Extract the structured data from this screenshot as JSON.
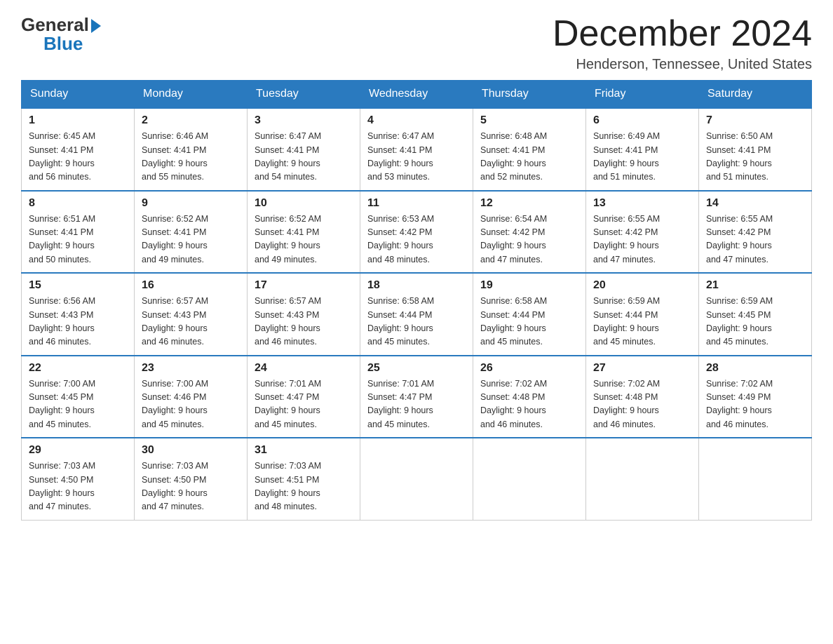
{
  "header": {
    "logo_general": "General",
    "logo_blue": "Blue",
    "month_title": "December 2024",
    "location": "Henderson, Tennessee, United States"
  },
  "days_of_week": [
    "Sunday",
    "Monday",
    "Tuesday",
    "Wednesday",
    "Thursday",
    "Friday",
    "Saturday"
  ],
  "weeks": [
    [
      {
        "date": "1",
        "sunrise": "6:45 AM",
        "sunset": "4:41 PM",
        "daylight": "9 hours and 56 minutes."
      },
      {
        "date": "2",
        "sunrise": "6:46 AM",
        "sunset": "4:41 PM",
        "daylight": "9 hours and 55 minutes."
      },
      {
        "date": "3",
        "sunrise": "6:47 AM",
        "sunset": "4:41 PM",
        "daylight": "9 hours and 54 minutes."
      },
      {
        "date": "4",
        "sunrise": "6:47 AM",
        "sunset": "4:41 PM",
        "daylight": "9 hours and 53 minutes."
      },
      {
        "date": "5",
        "sunrise": "6:48 AM",
        "sunset": "4:41 PM",
        "daylight": "9 hours and 52 minutes."
      },
      {
        "date": "6",
        "sunrise": "6:49 AM",
        "sunset": "4:41 PM",
        "daylight": "9 hours and 51 minutes."
      },
      {
        "date": "7",
        "sunrise": "6:50 AM",
        "sunset": "4:41 PM",
        "daylight": "9 hours and 51 minutes."
      }
    ],
    [
      {
        "date": "8",
        "sunrise": "6:51 AM",
        "sunset": "4:41 PM",
        "daylight": "9 hours and 50 minutes."
      },
      {
        "date": "9",
        "sunrise": "6:52 AM",
        "sunset": "4:41 PM",
        "daylight": "9 hours and 49 minutes."
      },
      {
        "date": "10",
        "sunrise": "6:52 AM",
        "sunset": "4:41 PM",
        "daylight": "9 hours and 49 minutes."
      },
      {
        "date": "11",
        "sunrise": "6:53 AM",
        "sunset": "4:42 PM",
        "daylight": "9 hours and 48 minutes."
      },
      {
        "date": "12",
        "sunrise": "6:54 AM",
        "sunset": "4:42 PM",
        "daylight": "9 hours and 47 minutes."
      },
      {
        "date": "13",
        "sunrise": "6:55 AM",
        "sunset": "4:42 PM",
        "daylight": "9 hours and 47 minutes."
      },
      {
        "date": "14",
        "sunrise": "6:55 AM",
        "sunset": "4:42 PM",
        "daylight": "9 hours and 47 minutes."
      }
    ],
    [
      {
        "date": "15",
        "sunrise": "6:56 AM",
        "sunset": "4:43 PM",
        "daylight": "9 hours and 46 minutes."
      },
      {
        "date": "16",
        "sunrise": "6:57 AM",
        "sunset": "4:43 PM",
        "daylight": "9 hours and 46 minutes."
      },
      {
        "date": "17",
        "sunrise": "6:57 AM",
        "sunset": "4:43 PM",
        "daylight": "9 hours and 46 minutes."
      },
      {
        "date": "18",
        "sunrise": "6:58 AM",
        "sunset": "4:44 PM",
        "daylight": "9 hours and 45 minutes."
      },
      {
        "date": "19",
        "sunrise": "6:58 AM",
        "sunset": "4:44 PM",
        "daylight": "9 hours and 45 minutes."
      },
      {
        "date": "20",
        "sunrise": "6:59 AM",
        "sunset": "4:44 PM",
        "daylight": "9 hours and 45 minutes."
      },
      {
        "date": "21",
        "sunrise": "6:59 AM",
        "sunset": "4:45 PM",
        "daylight": "9 hours and 45 minutes."
      }
    ],
    [
      {
        "date": "22",
        "sunrise": "7:00 AM",
        "sunset": "4:45 PM",
        "daylight": "9 hours and 45 minutes."
      },
      {
        "date": "23",
        "sunrise": "7:00 AM",
        "sunset": "4:46 PM",
        "daylight": "9 hours and 45 minutes."
      },
      {
        "date": "24",
        "sunrise": "7:01 AM",
        "sunset": "4:47 PM",
        "daylight": "9 hours and 45 minutes."
      },
      {
        "date": "25",
        "sunrise": "7:01 AM",
        "sunset": "4:47 PM",
        "daylight": "9 hours and 45 minutes."
      },
      {
        "date": "26",
        "sunrise": "7:02 AM",
        "sunset": "4:48 PM",
        "daylight": "9 hours and 46 minutes."
      },
      {
        "date": "27",
        "sunrise": "7:02 AM",
        "sunset": "4:48 PM",
        "daylight": "9 hours and 46 minutes."
      },
      {
        "date": "28",
        "sunrise": "7:02 AM",
        "sunset": "4:49 PM",
        "daylight": "9 hours and 46 minutes."
      }
    ],
    [
      {
        "date": "29",
        "sunrise": "7:03 AM",
        "sunset": "4:50 PM",
        "daylight": "9 hours and 47 minutes."
      },
      {
        "date": "30",
        "sunrise": "7:03 AM",
        "sunset": "4:50 PM",
        "daylight": "9 hours and 47 minutes."
      },
      {
        "date": "31",
        "sunrise": "7:03 AM",
        "sunset": "4:51 PM",
        "daylight": "9 hours and 48 minutes."
      },
      null,
      null,
      null,
      null
    ]
  ],
  "labels": {
    "sunrise_prefix": "Sunrise: ",
    "sunset_prefix": "Sunset: ",
    "daylight_prefix": "Daylight: "
  }
}
